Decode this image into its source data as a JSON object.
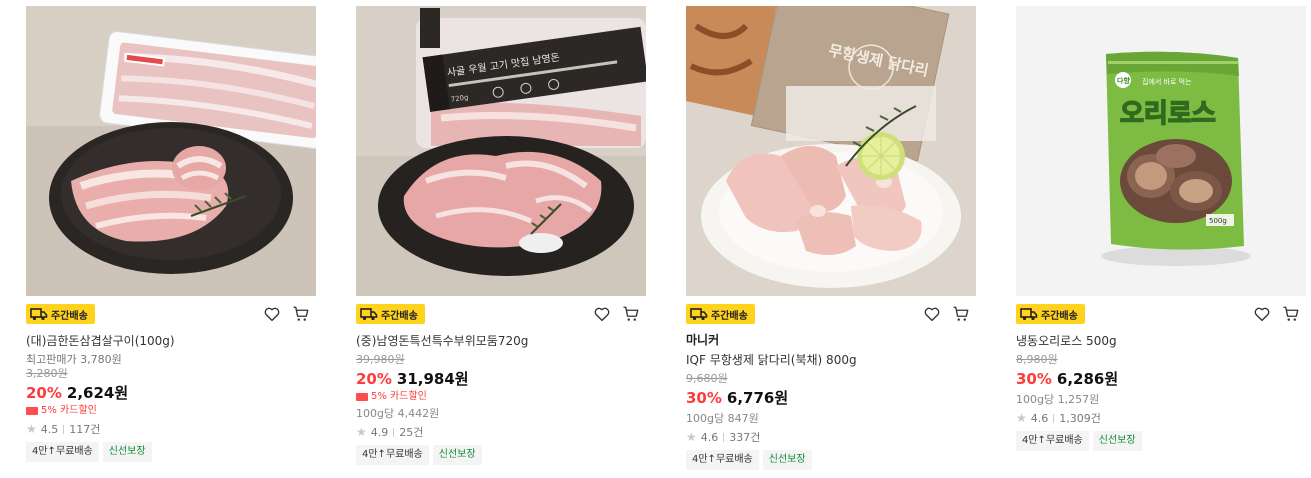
{
  "products": [
    {
      "badge": "주간배송",
      "brand": "",
      "name": "(대)금한돈삼겹살구이(100g)",
      "ref_price": "최고판매가 3,780원",
      "original_price": "3,280원",
      "discount_rate": "20%",
      "price": "2,624원",
      "card_discount": "5% 카드할인",
      "unit_price": "",
      "rating": "4.5",
      "review_count": "117건",
      "tags": [
        "4만↑무료배송",
        "신선보장"
      ]
    },
    {
      "badge": "주간배송",
      "brand": "",
      "name": "(중)남영돈특선특수부위모둠720g",
      "ref_price": "",
      "original_price": "39,980원",
      "discount_rate": "20%",
      "price": "31,984원",
      "card_discount": "5% 카드할인",
      "unit_price": "100g당 4,442원",
      "rating": "4.9",
      "review_count": "25건",
      "tags": [
        "4만↑무료배송",
        "신선보장"
      ]
    },
    {
      "badge": "주간배송",
      "brand": "마니커",
      "name": "IQF 무항생제 닭다리(북채) 800g",
      "ref_price": "",
      "original_price": "9,680원",
      "discount_rate": "30%",
      "price": "6,776원",
      "card_discount": "",
      "unit_price": "100g당 847원",
      "rating": "4.6",
      "review_count": "337건",
      "tags": [
        "4만↑무료배송",
        "신선보장"
      ]
    },
    {
      "badge": "주간배송",
      "brand": "",
      "name": "냉동오리로스 500g",
      "ref_price": "",
      "original_price": "8,980원",
      "discount_rate": "30%",
      "price": "6,286원",
      "card_discount": "",
      "unit_price": "100g당 1,257원",
      "rating": "4.6",
      "review_count": "1,309건",
      "tags": [
        "4만↑무료배송",
        "신선보장"
      ]
    }
  ],
  "images": {
    "product_1": {
      "tray_label": "",
      "package_text": ""
    },
    "product_2": {
      "package_text": "사골 우월 고기 맛집 남영돈",
      "package_sub": "720g"
    },
    "product_3": {
      "package_text": "무항생제 닭다리"
    },
    "product_4": {
      "package_brand": "다향",
      "package_text": "오리로스",
      "package_tagline": "집에서 바로 먹는",
      "package_weight": "500g"
    }
  },
  "icons": {
    "badge": "truck-icon",
    "wishlist": "heart-icon",
    "cart": "cart-icon",
    "rating": "star-icon",
    "card": "card-icon"
  },
  "colors": {
    "badge_bg": "#ffd21e",
    "discount": "#ff3b3b",
    "tag_green": "#128a3a"
  }
}
